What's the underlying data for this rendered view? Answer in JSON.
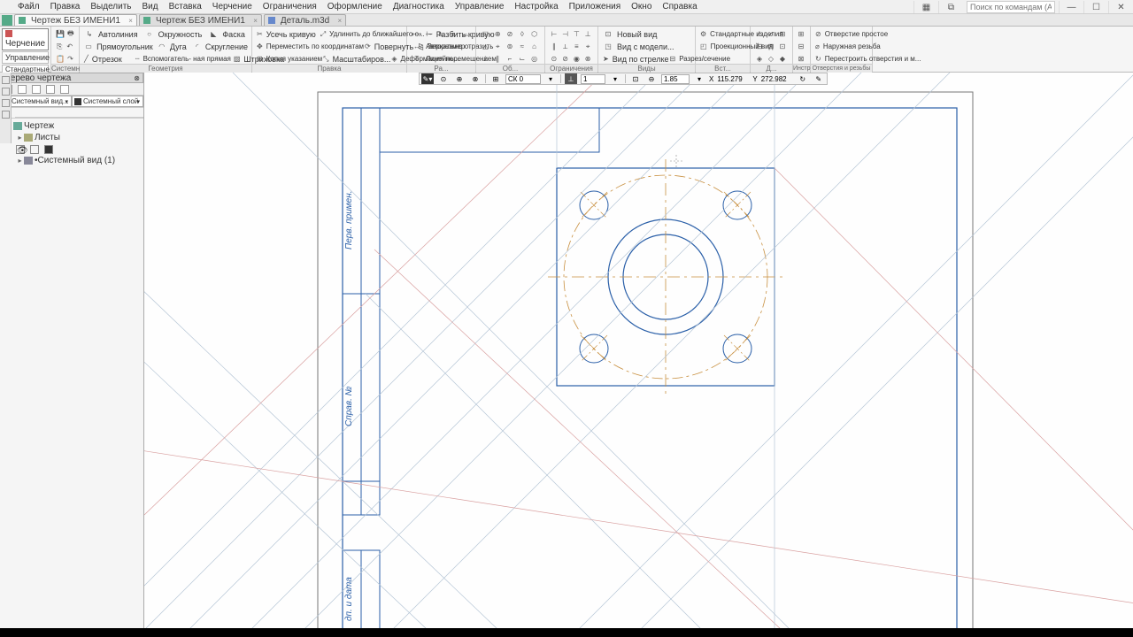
{
  "menu": {
    "items": [
      "Файл",
      "Правка",
      "Выделить",
      "Вид",
      "Вставка",
      "Черчение",
      "Ограничения",
      "Оформление",
      "Диагностика",
      "Управление",
      "Настройка",
      "Приложения",
      "Окно",
      "Справка"
    ]
  },
  "search": {
    "placeholder": "Поиск по командам (Alt+/)"
  },
  "tabs": [
    {
      "label": "Чертеж БЕЗ ИМЕНИ1",
      "active": true
    },
    {
      "label": "Чертеж БЕЗ ИМЕНИ1",
      "active": false
    },
    {
      "label": "Деталь.m3d",
      "active": false
    }
  ],
  "ribbon": {
    "modes": [
      "Черчение",
      "Управление",
      "Стандартные изделия"
    ],
    "active_mode": "Черчение",
    "groups": {
      "system": "Системная",
      "geometry": {
        "title": "Геометрия",
        "tools": [
          [
            "Автолиния",
            "Окружность",
            "Прямоугольник",
            "Отрезок"
          ],
          [
            "Фаска",
            "Дуга",
            "Скругление",
            "Штриховка"
          ],
          [
            "Вспомогатель-\\nная прямая"
          ]
        ]
      },
      "edit": {
        "title": "Правка",
        "tools": [
          "Усечь кривую",
          "Переместить по\\nкоординатам",
          "Копия\\nуказанием"
        ],
        "tools2": [
          "Удлинить до\\nближайшего о...",
          "Повернуть",
          "Масштабиров..."
        ],
        "tools3": [
          "Разбить кривую",
          "Зеркально\\nотразить",
          "Деформация\\nперемещением"
        ]
      },
      "dim": {
        "title": "Ра...",
        "line": "Линейны..."
      },
      "annot": {
        "title": "Об..."
      },
      "constraints": {
        "title": "Ограничения"
      },
      "views": {
        "title": "Виды",
        "tools": [
          "Новый вид",
          "Вид с модели...",
          "Вид по стрелке",
          "Разрез/сечение"
        ]
      },
      "insert": {
        "title": "Вст...",
        "tools": [
          "Стандартные\\nизделия",
          "Проекционный\\nвид"
        ]
      },
      "diag": {
        "title": "Д..."
      },
      "instr": {
        "title": "Инстр..."
      },
      "holes": {
        "title": "Отверстия и резьбы",
        "tools": [
          "Отверстие\\nпростое",
          "Наружная\\nрезьба",
          "Перестроить\\nотверстия и м..."
        ]
      }
    }
  },
  "panel": {
    "title": "Дерево чертежа",
    "combo1": "Системный вид...",
    "combo2": "Системный слой",
    "items": {
      "root": "Чертеж",
      "sheets": "Листы",
      "sysview": "Системный вид (1)"
    }
  },
  "minibar": {
    "cs": "СК 0",
    "scale": "1",
    "zoom": "1.85",
    "x": "115.279",
    "y": "272.982",
    "xlabel": "X",
    "ylabel": "Y"
  },
  "frame": {
    "col1": "Перв. примен.",
    "col2": "Справ. №",
    "col3": "дп. и дата"
  }
}
